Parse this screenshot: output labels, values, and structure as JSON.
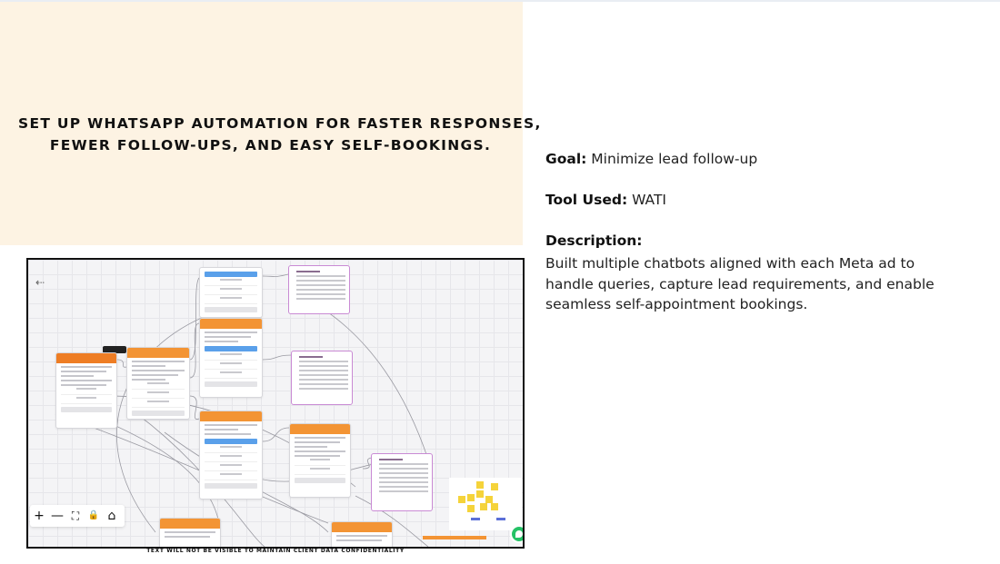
{
  "headline": {
    "line1": "SET UP WHATSAPP AUTOMATION FOR FASTER RESPONSES,",
    "line2": "FEWER FOLLOW-UPS, AND EASY SELF-BOOKINGS."
  },
  "details": {
    "goal_label": "Goal:",
    "goal_value": " Minimize lead follow-up",
    "tool_label": "Tool Used:",
    "tool_value": " WATI",
    "description_label": "Description:",
    "description_text": "Built multiple chatbots aligned with each Meta ad to handle queries, capture lead requirements, and enable seamless self-appointment bookings."
  },
  "screenshot": {
    "caption": "TEXT WILL NOT BE VISIBLE TO MAINTAIN CLIENT DATA CONFIDENTIALITY",
    "controls": {
      "back": "⇠",
      "zoom_in": "+",
      "zoom_out": "—",
      "fit": "⛶",
      "lock": "🔒",
      "home": "⌂"
    },
    "colors": {
      "node_header": "#f39434",
      "button": "#5aa0ea",
      "template_border": "#c98ad4",
      "sticky_note": "#f5d33a",
      "chat_button": "#25c266"
    }
  }
}
